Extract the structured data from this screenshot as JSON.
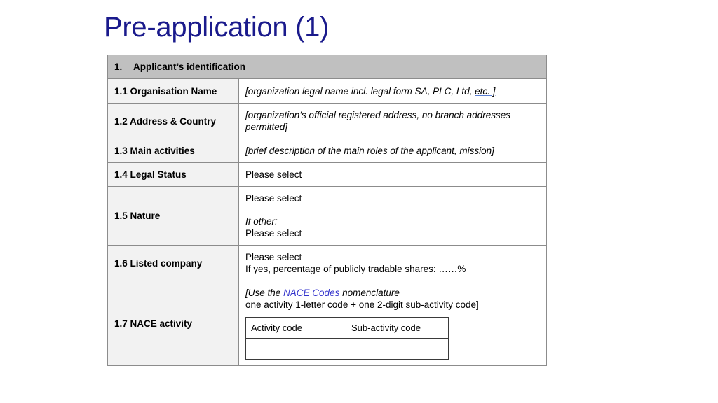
{
  "slide": {
    "title": "Pre-application (1)",
    "title_color": "#1a1a8c",
    "background_color": "#ffffff"
  },
  "table": {
    "header": {
      "number": "1.",
      "text": "Applicant’s identification",
      "background_color": "#c0c0c0"
    },
    "label_column_background": "#f2f2f2",
    "rows": [
      {
        "id": "1.1",
        "label": "1.1 Organisation Name",
        "value_prefix": "[organization legal name incl. legal form SA, PLC, Ltd, ",
        "value_underlined": "etc. ]",
        "style": "italic-placeholder"
      },
      {
        "id": "1.2",
        "label": "1.2 Address & Country",
        "value": "[organization’s official registered address, no branch addresses permitted]",
        "style": "italic-placeholder"
      },
      {
        "id": "1.3",
        "label": "1.3 Main activities",
        "value": "[brief description of the main roles of the applicant, mission]",
        "style": "italic-placeholder"
      },
      {
        "id": "1.4",
        "label": "1.4 Legal Status",
        "value": "Please select",
        "style": "plain"
      },
      {
        "id": "1.5",
        "label": "1.5 Nature",
        "value_line1": "Please select",
        "value_line2_italic": "If other:",
        "value_line3": "Please select",
        "style": "multi"
      },
      {
        "id": "1.6",
        "label": "1.6 Listed company",
        "value_line1": "Please select",
        "value_line2": "If yes, percentage of publicly tradable shares: ……%",
        "style": "multi"
      },
      {
        "id": "1.7",
        "label": "1.7 NACE activity",
        "value_pre": "[Use ",
        "value_the": "the ",
        "value_link": "NACE Codes",
        "value_post": " nomenclature",
        "value_line2": "one activity 1-letter code + one 2-digit sub-activity code]",
        "link_color": "#3333cc",
        "style": "nace"
      }
    ]
  },
  "nace_table": {
    "headers": [
      "Activity code",
      "Sub-activity code"
    ],
    "values": [
      "",
      ""
    ]
  }
}
